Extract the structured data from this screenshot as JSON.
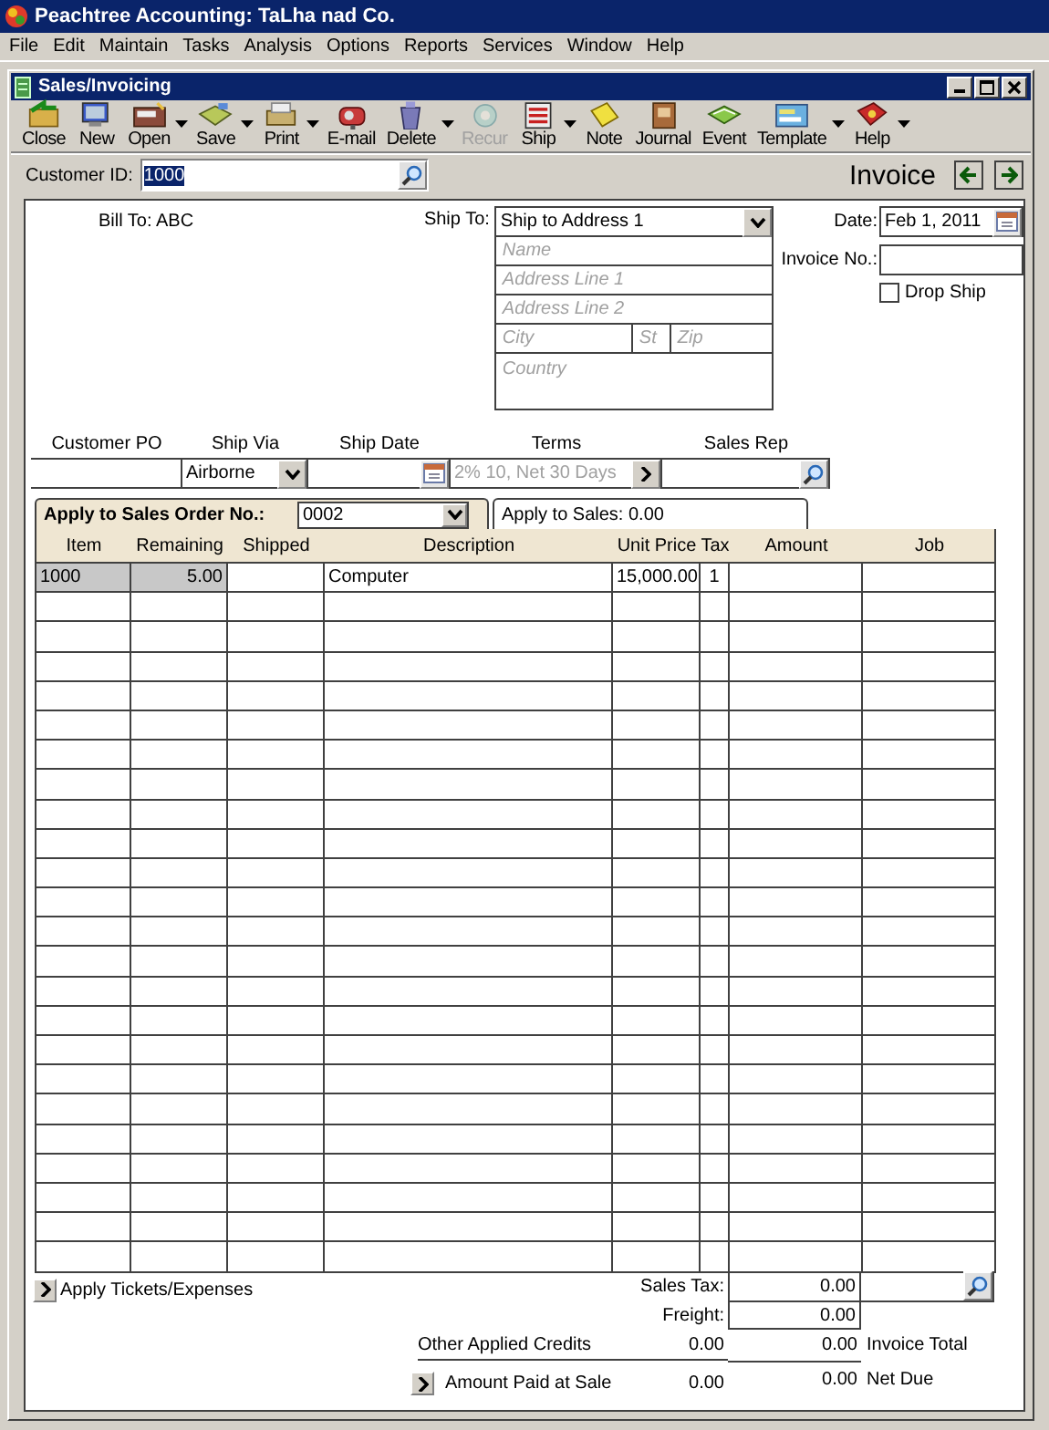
{
  "app": {
    "title": "Peachtree Accounting: TaLha nad Co."
  },
  "menu": [
    "File",
    "Edit",
    "Maintain",
    "Tasks",
    "Analysis",
    "Options",
    "Reports",
    "Services",
    "Window",
    "Help"
  ],
  "window": {
    "title": "Sales/Invoicing"
  },
  "toolbar": [
    {
      "label": "Close",
      "kind": "close",
      "dropdown": false,
      "disabled": false
    },
    {
      "label": "New",
      "kind": "new",
      "dropdown": false,
      "disabled": false
    },
    {
      "label": "Open",
      "kind": "open",
      "dropdown": true,
      "disabled": false
    },
    {
      "label": "Save",
      "kind": "save",
      "dropdown": true,
      "disabled": false
    },
    {
      "label": "Print",
      "kind": "print",
      "dropdown": true,
      "disabled": false
    },
    {
      "label": "E-mail",
      "kind": "email",
      "dropdown": false,
      "disabled": false
    },
    {
      "label": "Delete",
      "kind": "delete",
      "dropdown": true,
      "disabled": false
    },
    {
      "label": "Recur",
      "kind": "recur",
      "dropdown": false,
      "disabled": true
    },
    {
      "label": "Ship",
      "kind": "ship",
      "dropdown": true,
      "disabled": false
    },
    {
      "label": "Note",
      "kind": "note",
      "dropdown": false,
      "disabled": false
    },
    {
      "label": "Journal",
      "kind": "journal",
      "dropdown": false,
      "disabled": false
    },
    {
      "label": "Event",
      "kind": "event",
      "dropdown": false,
      "disabled": false
    },
    {
      "label": "Template",
      "kind": "template",
      "dropdown": true,
      "disabled": false
    },
    {
      "label": "Help",
      "kind": "help",
      "dropdown": true,
      "disabled": false
    }
  ],
  "customer": {
    "label": "Customer ID:",
    "value": "1000",
    "selected": true
  },
  "doc_title": "Invoice",
  "bill_to": {
    "label": "Bill To:",
    "value": "ABC"
  },
  "ship_to": {
    "label": "Ship To:",
    "value": "Ship to Address 1",
    "name": {
      "placeholder": "Name"
    },
    "address_line_1": {
      "placeholder": "Address Line 1"
    },
    "address_line_2": {
      "placeholder": "Address Line 2"
    },
    "city": {
      "placeholder": "City"
    },
    "state": {
      "placeholder": "St"
    },
    "zip": {
      "placeholder": "Zip"
    },
    "country": {
      "placeholder": "Country"
    }
  },
  "date": {
    "label": "Date:",
    "value": "Feb 1, 2011"
  },
  "invoice_no": {
    "label": "Invoice No.:"
  },
  "drop_ship": {
    "label": "Drop Ship",
    "checked": false
  },
  "customer_po": {
    "label": "Customer PO"
  },
  "ship_via": {
    "label": "Ship Via",
    "value": "Airborne"
  },
  "ship_date": {
    "label": "Ship Date"
  },
  "terms": {
    "label": "Terms",
    "placeholder": "2% 10, Net 30 Days"
  },
  "sales_rep": {
    "label": "Sales Rep"
  },
  "apply_tabs": [
    {
      "label": "Apply to Sales Order No.:",
      "value": "0002",
      "selected": true
    },
    {
      "label": "Apply to Sales: 0.00",
      "selected": false
    }
  ],
  "table": {
    "columns": [
      "Item",
      "Remaining",
      "Shipped",
      "Description",
      "Unit Price",
      "Tax",
      "Amount",
      "Job"
    ],
    "rows": [
      {
        "item": "1000",
        "remaining": "5.00",
        "description": "Computer",
        "unit_price": "15,000.00",
        "tax": "1"
      }
    ]
  },
  "apply_tickets": {
    "label": "Apply Tickets/Expenses"
  },
  "sales_tax": {
    "label": "Sales Tax:",
    "value": "0.00"
  },
  "freight": {
    "label": "Freight:",
    "value": "0.00"
  },
  "other_credits": {
    "label": "Other Applied Credits",
    "value": "0.00"
  },
  "invoice_total": {
    "label": "Invoice Total",
    "value": "0.00"
  },
  "amount_paid": {
    "label": "Amount Paid at Sale",
    "value": "0.00"
  },
  "net_due": {
    "label": "Net Due",
    "value": "0.00"
  }
}
